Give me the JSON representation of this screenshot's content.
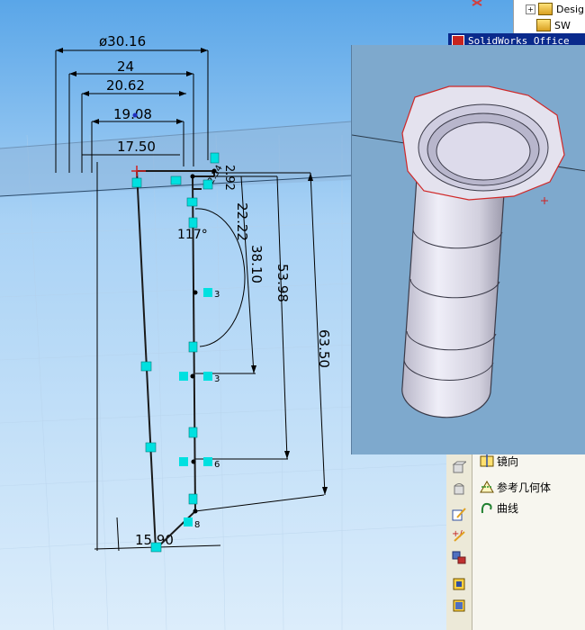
{
  "feature_tree": {
    "items": [
      {
        "label": "Design",
        "expander": "+"
      },
      {
        "label": "SW"
      }
    ]
  },
  "title_strip": {
    "text": "SolidWorks Office"
  },
  "sketch_dimensions": {
    "diameter_top": "ø30.16",
    "width_24": "24",
    "width_20_62": "20.62",
    "width_19_08": "19.08",
    "width_17_50": "17.50",
    "width_15_90": "15.90",
    "angle": "117°",
    "small_2_92": "2.92",
    "small_2_54": "2.54",
    "height_22_22": "22.22",
    "height_38_10": "38.10",
    "height_53_98": "53.98",
    "height_63_50": "63.50"
  },
  "relation_badges": [
    "3",
    "3",
    "6",
    "8"
  ],
  "menu": {
    "items": [
      {
        "label": "镜向",
        "icon": "mirror-icon"
      },
      {
        "label": "参考几何体",
        "icon": "reference-geometry-icon"
      },
      {
        "label": "曲线",
        "icon": "curve-icon"
      }
    ]
  },
  "toolbar_icons": [
    "extrude-icon",
    "revolve-icon",
    "sketch-edit-icon",
    "smart-dimension-icon",
    "relation-icon",
    "feature-a-icon",
    "feature-b-icon"
  ],
  "colors": {
    "viewport_bg": "#cfe6fb",
    "sketch_line": "#1a1a1a",
    "relation_marker": "#00e0e0",
    "origin": "#d02020",
    "preview_bg": "#7ea9cd",
    "menu_bg": "#f7f6ef"
  }
}
